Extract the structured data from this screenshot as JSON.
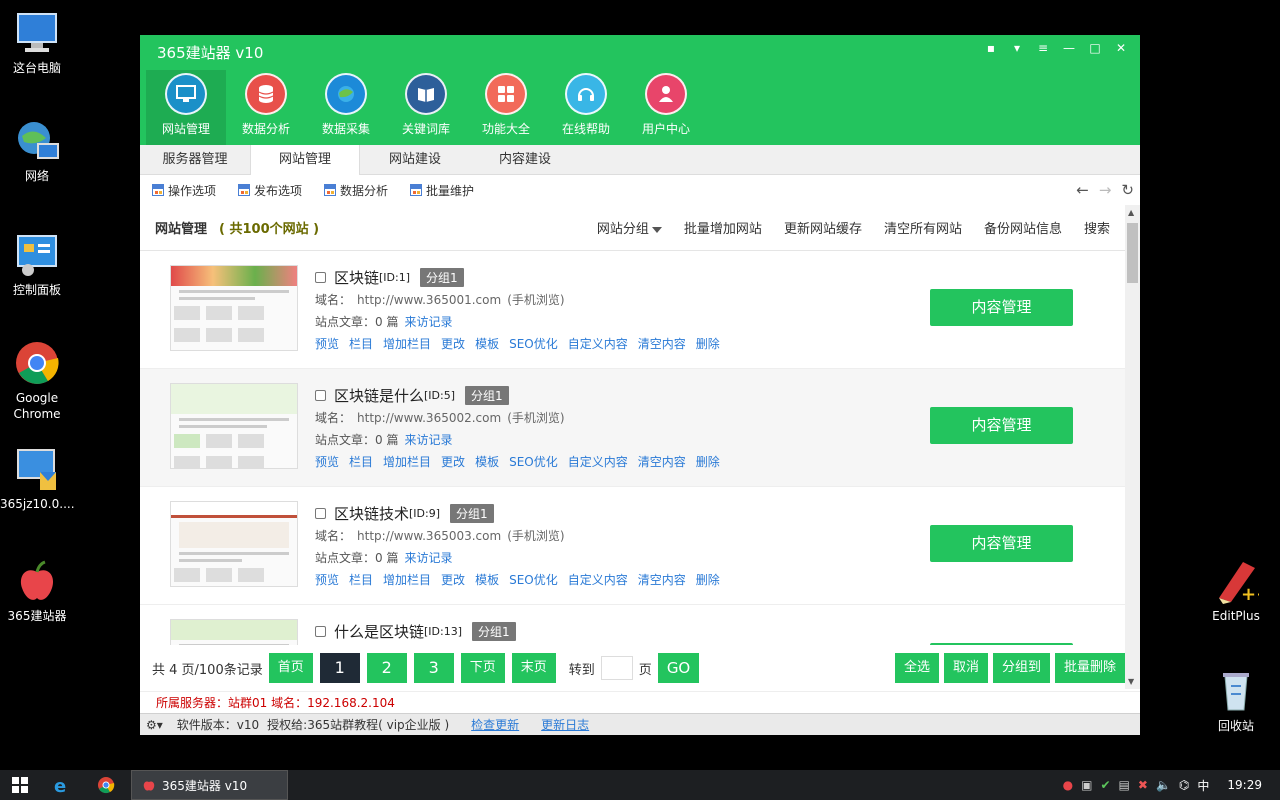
{
  "desktop": {
    "icons": [
      {
        "label": "这台电脑"
      },
      {
        "label": "网络"
      },
      {
        "label": "控制面板"
      },
      {
        "label": "Google Chrome"
      },
      {
        "label": "365jz10.0...."
      },
      {
        "label": "365建站器"
      },
      {
        "label": "EditPlus"
      },
      {
        "label": "回收站"
      }
    ]
  },
  "app": {
    "title": "365建站器 v10",
    "nav": [
      {
        "label": "网站管理",
        "icon": "monitor-icon",
        "color": "#1b90c8"
      },
      {
        "label": "数据分析",
        "icon": "database-icon",
        "color": "#e8504a"
      },
      {
        "label": "数据采集",
        "icon": "globe-icon",
        "color": "#1c8ad8"
      },
      {
        "label": "关键词库",
        "icon": "book-icon",
        "color": "#2d5f9a"
      },
      {
        "label": "功能大全",
        "icon": "grid-icon",
        "color": "#f26a5a"
      },
      {
        "label": "在线帮助",
        "icon": "headset-icon",
        "color": "#39b6e6"
      },
      {
        "label": "用户中心",
        "icon": "user-icon",
        "color": "#e8456a"
      }
    ],
    "tabs": [
      "服务器管理",
      "网站管理",
      "网站建设",
      "内容建设"
    ],
    "subtools": [
      "操作选项",
      "发布选项",
      "数据分析",
      "批量维护"
    ],
    "header": {
      "title": "网站管理",
      "count": "( 共100个网站 )",
      "group": "网站分组",
      "actions": [
        "批量增加网站",
        "更新网站缓存",
        "清空所有网站",
        "备份网站信息",
        "搜索"
      ]
    },
    "labels": {
      "domain": "域名：",
      "mobile": "(手机浏览)",
      "articles": "站点文章：0 篇",
      "visits": "来访记录",
      "content_btn": "内容管理"
    },
    "site_actions": [
      "预览",
      "栏目",
      "增加栏目",
      "更改",
      "模板",
      "SEO优化",
      "自定义内容",
      "清空内容",
      "删除"
    ],
    "sites": [
      {
        "name": "区块链",
        "id": "[ID:1]",
        "group": "分组1",
        "url": "http://www.365001.com"
      },
      {
        "name": "区块链是什么",
        "id": "[ID:5]",
        "group": "分组1",
        "url": "http://www.365002.com"
      },
      {
        "name": "区块链技术",
        "id": "[ID:9]",
        "group": "分组1",
        "url": "http://www.365003.com"
      },
      {
        "name": "什么是区块链",
        "id": "[ID:13]",
        "group": "分组1",
        "url": ""
      }
    ],
    "pager": {
      "total": "共 4 页/100条记录",
      "first": "首页",
      "pages": [
        "1",
        "2",
        "3"
      ],
      "next": "下页",
      "last": "末页",
      "goto": "转到",
      "page_unit": "页",
      "go": "GO",
      "right": [
        "全选",
        "取消",
        "分组到",
        "批量删除"
      ]
    },
    "server_info": "所属服务器：站群01 域名：192.168.2.104",
    "status": {
      "version": "软件版本：v10",
      "license": "授权给:365站群教程( vip企业版 )",
      "check_update": "检查更新",
      "changelog": "更新日志"
    }
  },
  "taskbar": {
    "app_label": "365建站器 v10",
    "time": "19:29",
    "ime": "中"
  }
}
